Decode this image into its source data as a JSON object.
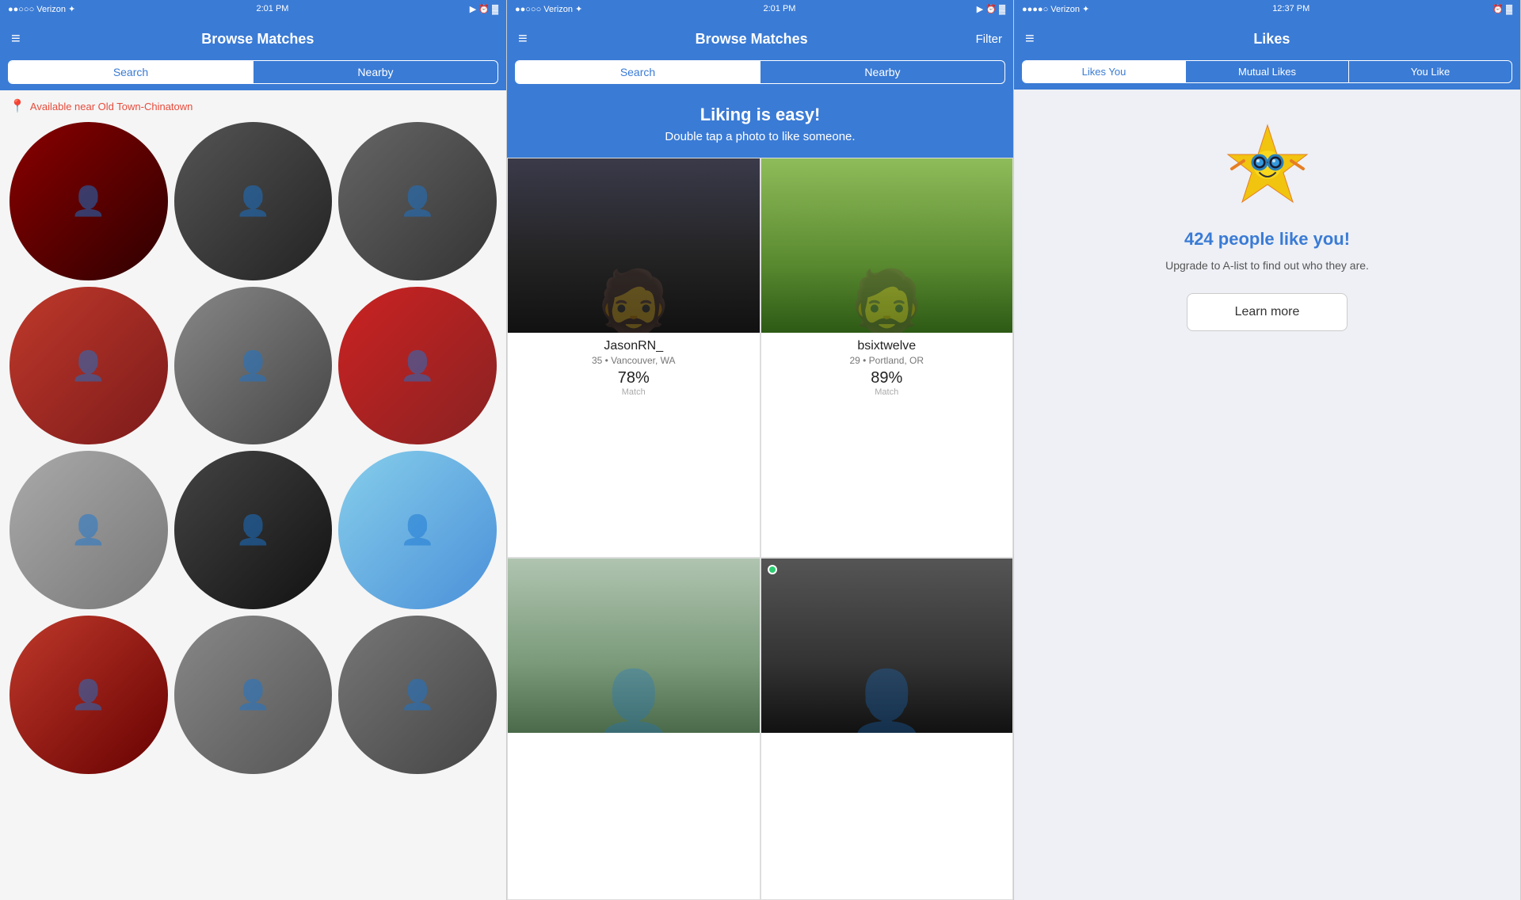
{
  "panel1": {
    "status": {
      "carrier": "●●○○○ Verizon ✦",
      "time": "2:01 PM",
      "icons": "▶ ⏰ 🔋"
    },
    "nav": {
      "hamburger": "≡",
      "title": "Browse Matches",
      "right": ""
    },
    "tabs": {
      "search": "Search",
      "nearby": "Nearby"
    },
    "location": "Available near Old Town-Chinatown",
    "avatars": [
      {
        "id": "av1"
      },
      {
        "id": "av2"
      },
      {
        "id": "av3"
      },
      {
        "id": "av4"
      },
      {
        "id": "av5"
      },
      {
        "id": "av6"
      },
      {
        "id": "av7"
      },
      {
        "id": "av8"
      },
      {
        "id": "av9"
      },
      {
        "id": "av10"
      },
      {
        "id": "av11"
      },
      {
        "id": "av12"
      }
    ]
  },
  "panel2": {
    "status": {
      "carrier": "●●○○○ Verizon ✦",
      "time": "2:01 PM",
      "icons": "▶ ⏰ 🔋"
    },
    "nav": {
      "hamburger": "≡",
      "title": "Browse Matches",
      "filter": "Filter"
    },
    "tabs": {
      "search": "Search",
      "nearby": "Nearby"
    },
    "banner": {
      "title": "Liking is easy!",
      "subtitle": "Double tap a photo to like someone."
    },
    "matches": [
      {
        "name": "JasonRN_",
        "detail": "35 • Vancouver, WA",
        "percent": "78%",
        "label": "Match",
        "hasOnline": false,
        "photoClass": "mp1"
      },
      {
        "name": "bsixtwelve",
        "detail": "29 • Portland, OR",
        "percent": "89%",
        "label": "Match",
        "hasOnline": false,
        "photoClass": "mp2"
      },
      {
        "name": "",
        "detail": "",
        "percent": "",
        "label": "",
        "hasOnline": false,
        "photoClass": "mp3"
      },
      {
        "name": "",
        "detail": "",
        "percent": "",
        "label": "",
        "hasOnline": true,
        "photoClass": "mp4"
      }
    ]
  },
  "panel3": {
    "status": {
      "carrier": "●●●●○ Verizon ✦",
      "time": "12:37 PM",
      "icons": "⏰ 🔋"
    },
    "nav": {
      "hamburger": "≡",
      "title": "Likes",
      "right": ""
    },
    "tabs": {
      "likesYou": "Likes You",
      "mutualLikes": "Mutual Likes",
      "youLike": "You Like"
    },
    "likesCount": "424 people like you!",
    "likesSub": "Upgrade to A-list to find out who they are.",
    "learnMore": "Learn more"
  }
}
